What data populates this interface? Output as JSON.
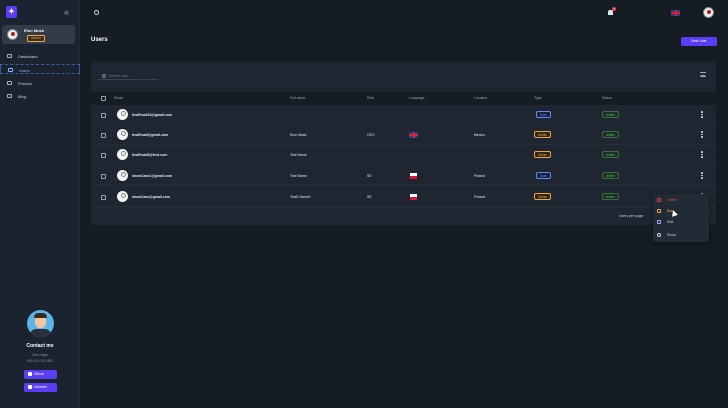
{
  "sidebar": {
    "logo": "✦",
    "user": {
      "name": "Elon Musk",
      "role": "Admin"
    },
    "nav": [
      {
        "label": "Dashboard"
      },
      {
        "label": "Users"
      },
      {
        "label": "Product"
      },
      {
        "label": "Blog"
      }
    ],
    "contact": {
      "title": "Contact me",
      "lines": [
        "Deb Hage",
        "040 101 102 803"
      ],
      "github": "Github",
      "linkedin": "Linkedin"
    }
  },
  "topbar": {
    "notification_count": "1"
  },
  "page": {
    "title": "Users",
    "new_button": "New User"
  },
  "table": {
    "search_placeholder": "Search user...",
    "columns": [
      "Email",
      "Full name",
      "Role",
      "Language",
      "Location",
      "Type",
      "Status"
    ],
    "rows": [
      {
        "email": "testEmail16@gmail.com",
        "name": "",
        "role": "",
        "language": "",
        "location": "",
        "type": "User",
        "status": "Active"
      },
      {
        "email": "testEmail@gmail.com",
        "name": "Elon Musk",
        "role": "CEO",
        "language": "en",
        "location": "Mexico",
        "type": "Admin",
        "status": "Active"
      },
      {
        "email": "testEmail3@test.com",
        "name": "Test Name",
        "role": "",
        "language": "",
        "location": "",
        "type": "Admin",
        "status": "Active"
      },
      {
        "email": "showCase1@gmail.com",
        "name": "Test Name",
        "role": "SE",
        "language": "pl",
        "location": "Poland",
        "type": "User",
        "status": "Active"
      },
      {
        "email": "showCase@gmail.com",
        "name": "Test2 Name2",
        "role": "SE",
        "language": "pl",
        "location": "Poland",
        "type": "Admin",
        "status": "Active"
      }
    ],
    "rows_per_page_label": "Users per page:"
  },
  "row_menu": {
    "items": [
      {
        "label": "Delete",
        "color": "#e0454b"
      },
      {
        "label": "Ban",
        "color": "#f0a742"
      },
      {
        "label": "Edit",
        "color": "#cfd5de"
      },
      {
        "label": "Show",
        "color": "#cfd5de"
      }
    ]
  },
  "colors": {
    "accent": "#5b3df5",
    "background": "#161c24",
    "card": "#1f2632"
  }
}
